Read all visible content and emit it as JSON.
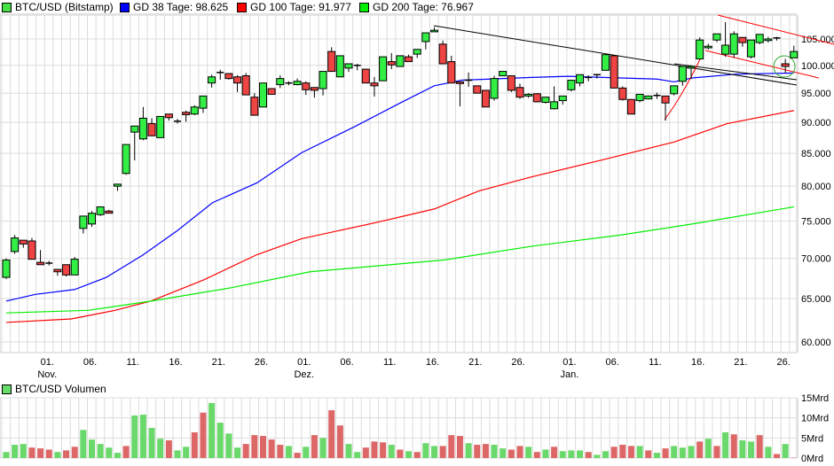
{
  "legend": [
    {
      "label": "BTC/USD (Bitstamp)",
      "color": "#44e044"
    },
    {
      "label": "GD 38 Tage: 98.625",
      "color": "#0000ff"
    },
    {
      "label": "GD 100 Tage: 91.977",
      "color": "#ff0000"
    },
    {
      "label": "GD 200 Tage: 76.967",
      "color": "#00ee00"
    }
  ],
  "volume_legend": {
    "label": "BTC/USD Volumen",
    "color": "#66dd66"
  },
  "colors": {
    "up": "#33ee44",
    "down": "#ee4444",
    "vol_up": "#6ad86a",
    "vol_down": "#dd6666",
    "grid": "#dcdcdc"
  },
  "chart_data": [
    {
      "type": "candlestick",
      "scale": "log",
      "ylim": [
        58,
        108
      ],
      "y_ticks": [
        "105.000",
        "100.000",
        "95.000",
        "90.000",
        "85.000",
        "80.000",
        "75.000",
        "70.000",
        "65.000",
        "60.000"
      ],
      "y_tick_values": [
        105,
        100,
        95,
        90,
        85,
        80,
        75,
        70,
        65,
        60
      ],
      "x_ticks": [
        {
          "day": 5,
          "label": "01.",
          "month": "Nov."
        },
        {
          "day": 10,
          "label": "06."
        },
        {
          "day": 15,
          "label": "11."
        },
        {
          "day": 20,
          "label": "16."
        },
        {
          "day": 25,
          "label": "21."
        },
        {
          "day": 30,
          "label": "26."
        },
        {
          "day": 35,
          "label": "01.",
          "month": "Dez."
        },
        {
          "day": 40,
          "label": "06."
        },
        {
          "day": 45,
          "label": "11."
        },
        {
          "day": 50,
          "label": "16."
        },
        {
          "day": 55,
          "label": "21."
        },
        {
          "day": 60,
          "label": "26."
        },
        {
          "day": 66,
          "label": "01.",
          "month": "Jan."
        },
        {
          "day": 71,
          "label": "06."
        },
        {
          "day": 76,
          "label": "11."
        },
        {
          "day": 81,
          "label": "16."
        },
        {
          "day": 86,
          "label": "21."
        },
        {
          "day": 91,
          "label": "26."
        }
      ],
      "grid": true,
      "ohlc": [
        [
          67.6,
          69.8,
          70,
          67.4
        ],
        [
          70.9,
          72.7,
          73.1,
          70.6
        ],
        [
          72.4,
          71.9,
          72.4,
          71.4
        ],
        [
          72.3,
          69.9,
          72.7,
          69.9
        ],
        [
          69.5,
          69.2,
          71.1,
          69.2
        ],
        [
          69.4,
          69.4,
          69.7,
          69.1
        ],
        [
          68.6,
          68.3,
          68.6,
          67.8
        ],
        [
          69.2,
          67.9,
          69.2,
          67.7
        ],
        [
          67.9,
          69.9,
          70.2,
          67.9
        ],
        [
          74,
          75.7,
          75.7,
          73.3
        ],
        [
          74.6,
          76.1,
          76.4,
          74.2
        ],
        [
          75.9,
          77,
          77,
          75.7
        ],
        [
          76.4,
          76.1,
          76.6,
          76.1
        ],
        [
          80,
          80.3,
          80.3,
          79.3
        ],
        [
          81.9,
          86.4,
          86.4,
          81.7
        ],
        [
          88.4,
          89.4,
          89.4,
          83.9
        ],
        [
          87.3,
          90.7,
          92.6,
          87.1
        ],
        [
          89.8,
          87.8,
          90.7,
          87.8
        ],
        [
          87.5,
          91,
          91,
          87.5
        ],
        [
          91.4,
          90.8,
          91.4,
          90.3
        ],
        [
          90.2,
          90.2,
          90.6,
          89.8
        ],
        [
          91.7,
          91.3,
          92,
          90.1
        ],
        [
          91.4,
          92.6,
          92.9,
          91.2
        ],
        [
          92.4,
          94.5,
          94.5,
          91.6
        ],
        [
          96.8,
          97.9,
          98.3,
          96
        ],
        [
          98.7,
          98.7,
          99.2,
          97.4
        ],
        [
          98.5,
          97.6,
          98.6,
          97.4
        ],
        [
          97.9,
          96.8,
          98.2,
          95.2
        ],
        [
          98.1,
          94.7,
          98.6,
          94.7
        ],
        [
          94.3,
          91.2,
          95,
          91.2
        ],
        [
          92.6,
          96.8,
          96.8,
          92.6
        ],
        [
          95.8,
          94.8,
          95.8,
          94.8
        ],
        [
          96.5,
          97.6,
          98.2,
          95.9
        ],
        [
          96.8,
          96.8,
          97.1,
          96.4
        ],
        [
          96.5,
          97.1,
          97.6,
          96.4
        ],
        [
          96.8,
          95.6,
          97.1,
          94.7
        ],
        [
          96,
          95.5,
          96,
          94.2
        ],
        [
          95.8,
          98.9,
          98.9,
          94.6
        ],
        [
          102.6,
          98.9,
          103.4,
          98.9
        ],
        [
          97.9,
          101.8,
          101.8,
          97.9
        ],
        [
          99.5,
          100.3,
          100.3,
          98.8
        ],
        [
          100,
          100,
          100.3,
          99.1
        ],
        [
          99.3,
          96.8,
          99.3,
          96.8
        ],
        [
          96.8,
          96.3,
          97.9,
          94.4
        ],
        [
          97.2,
          101.6,
          101.6,
          97.2
        ],
        [
          100.7,
          100.1,
          102.3,
          99.3
        ],
        [
          99.8,
          101.8,
          101.8,
          99.8
        ],
        [
          101.6,
          100.7,
          102,
          100.7
        ],
        [
          102.1,
          103,
          103,
          101.4
        ],
        [
          104.5,
          106.2,
          106.2,
          103
        ],
        [
          106.4,
          106.7,
          107.3,
          106.4
        ],
        [
          104,
          100.3,
          104.7,
          100.3
        ],
        [
          100.7,
          96.8,
          101.8,
          96.8
        ],
        [
          97,
          96.7,
          97,
          92.7
        ],
        [
          97.3,
          97.3,
          98.7,
          96.1
        ],
        [
          96.3,
          95,
          96.3,
          95
        ],
        [
          95.5,
          92.6,
          95.5,
          92.6
        ],
        [
          94.1,
          97.6,
          98.1,
          93.7
        ],
        [
          98.1,
          98.9,
          98.9,
          98
        ],
        [
          98.1,
          95.5,
          98.1,
          95.2
        ],
        [
          96,
          94.3,
          96.7,
          94
        ],
        [
          94.5,
          94.8,
          95,
          94.2
        ],
        [
          94.9,
          93.5,
          95,
          93.4
        ],
        [
          93.4,
          94.3,
          94.3,
          93.2
        ],
        [
          92.3,
          93.5,
          96.2,
          92.2
        ],
        [
          93.7,
          94.5,
          94.5,
          93
        ],
        [
          95.6,
          97.3,
          97.3,
          95.3
        ],
        [
          96.8,
          98.3,
          98.3,
          96.2
        ],
        [
          97.8,
          97.8,
          98.2,
          97.1
        ],
        [
          98.3,
          98.1,
          98.3,
          97.6
        ],
        [
          99.1,
          102,
          102,
          99.1
        ],
        [
          101.8,
          95.9,
          101.8,
          95.9
        ],
        [
          95.9,
          93.9,
          96.2,
          93.7
        ],
        [
          93.9,
          91.4,
          93.9,
          91.4
        ],
        [
          93.7,
          94.8,
          94.8,
          93.4
        ],
        [
          94,
          94.5,
          94.6,
          94
        ],
        [
          94.6,
          94.6,
          95.1,
          94
        ],
        [
          94.5,
          93.3,
          94.5,
          90.3
        ],
        [
          94.9,
          96.3,
          96.3,
          94.6
        ],
        [
          97.1,
          99.8,
          99.8,
          96.3
        ],
        [
          99.5,
          99.8,
          100,
          97.5
        ],
        [
          101.2,
          104.8,
          105.3,
          101.2
        ],
        [
          103.3,
          103.6,
          104.1,
          103
        ],
        [
          104.8,
          106,
          106,
          104.4
        ],
        [
          102.1,
          103.8,
          108.3,
          101.6
        ],
        [
          102.1,
          106,
          106.5,
          101.4
        ],
        [
          105.3,
          104.3,
          105.3,
          103.5
        ],
        [
          101.6,
          104.8,
          104.8,
          101.3
        ],
        [
          104.3,
          105.9,
          105.9,
          104
        ],
        [
          104.7,
          105,
          105.4,
          104.3
        ],
        [
          105.2,
          105,
          105.4,
          104.7
        ],
        [
          100.3,
          99.8,
          101.2,
          98.6
        ],
        [
          101.4,
          102.6,
          103.7,
          101.4
        ]
      ],
      "series": [
        {
          "name": "GD 38 Tage",
          "color": "#0000ff",
          "points": [
            [
              0,
              64.7
            ],
            [
              3.4,
              65.5
            ],
            [
              8,
              66.1
            ],
            [
              11.7,
              67.6
            ],
            [
              15.9,
              70.4
            ],
            [
              20,
              73.7
            ],
            [
              24.1,
              77.6
            ],
            [
              29.3,
              80.5
            ],
            [
              34.5,
              85.1
            ],
            [
              40.7,
              89.3
            ],
            [
              45.9,
              93.2
            ],
            [
              50,
              96.3
            ],
            [
              53.2,
              97.3
            ],
            [
              61.4,
              97.8
            ],
            [
              65.6,
              98
            ],
            [
              71.8,
              97.7
            ],
            [
              76,
              97.5
            ],
            [
              78,
              97
            ],
            [
              80.1,
              97.7
            ],
            [
              85.3,
              98.4
            ],
            [
              92,
              98.6
            ]
          ]
        },
        {
          "name": "GD 100 Tage",
          "color": "#ff0000",
          "points": [
            [
              0,
              62.2
            ],
            [
              7.6,
              62.6
            ],
            [
              12.7,
              63.6
            ],
            [
              16.9,
              64.7
            ],
            [
              23.1,
              67.3
            ],
            [
              29.3,
              70.5
            ],
            [
              34.5,
              72.6
            ],
            [
              42.8,
              74.7
            ],
            [
              50,
              76.7
            ],
            [
              55.2,
              79.3
            ],
            [
              61.4,
              81.4
            ],
            [
              69.7,
              84
            ],
            [
              78,
              86.8
            ],
            [
              84.2,
              89.8
            ],
            [
              92,
              92
            ]
          ]
        },
        {
          "name": "GD 200 Tage",
          "color": "#00ee00",
          "points": [
            [
              0,
              63.3
            ],
            [
              9.6,
              63.6
            ],
            [
              16.9,
              64.7
            ],
            [
              26.2,
              66.3
            ],
            [
              35.5,
              68.3
            ],
            [
              51.1,
              69.8
            ],
            [
              61.4,
              71.6
            ],
            [
              71.8,
              73.1
            ],
            [
              80.1,
              74.6
            ],
            [
              92,
              77
            ]
          ]
        }
      ]
    },
    {
      "type": "bar",
      "title": "BTC/USD Volumen",
      "ylim": [
        0,
        15
      ],
      "y_ticks": [
        "15Mrd",
        "10Mrd",
        "5Mrd",
        "0Mrd"
      ],
      "y_tick_values": [
        15,
        10,
        5,
        0
      ],
      "values": [
        1.5,
        3.3,
        3.5,
        2.6,
        2.4,
        2.1,
        1.5,
        1.9,
        2.8,
        7.0,
        4.6,
        3.5,
        2.6,
        1.3,
        3.0,
        10.6,
        10.8,
        7.5,
        4.8,
        4.4,
        1.9,
        2.8,
        6.4,
        11.3,
        13.7,
        8.8,
        6.1,
        2.6,
        3.5,
        5.7,
        5.5,
        4.6,
        3.3,
        3.0,
        1.3,
        2.8,
        5.7,
        5.0,
        11.9,
        8.1,
        3.5,
        1.5,
        2.6,
        4.1,
        3.9,
        3.3,
        2.1,
        1.7,
        1.5,
        3.7,
        3.0,
        3.0,
        5.7,
        5.5,
        3.7,
        3.3,
        3.5,
        3.3,
        2.4,
        2.1,
        3.0,
        2.8,
        1.5,
        2.1,
        2.8,
        1.7,
        1.9,
        1.9,
        1.5,
        0.8,
        1.7,
        2.8,
        3.3,
        3.0,
        3.0,
        1.9,
        1.3,
        2.4,
        3.0,
        2.6,
        3.0,
        4.1,
        4.8,
        3.0,
        6.4,
        5.9,
        4.4,
        4.1,
        5.7,
        2.8,
        1.0,
        3.5,
        0.1
      ],
      "directions": "gggrrrgrrgggggrggggrggrrggggrrrrrgrgrgrrggrrrgrgrggrrrgrrggrrgrgrgggrggrrrgrgrgggrgrgrggrgrg"
    }
  ]
}
